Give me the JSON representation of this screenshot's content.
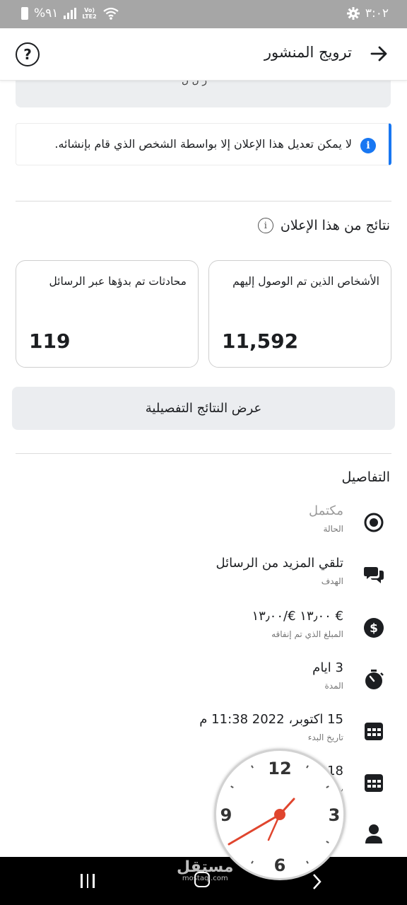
{
  "status_bar": {
    "time": "٣:٠٢",
    "battery": "%٩١",
    "network_top": "Vo)",
    "network_bottom": "LTE2"
  },
  "header": {
    "title": "ترويج المنشور"
  },
  "partial_top_text": "ر ل ل",
  "notice": {
    "text": "لا يمكن تعديل هذا الإعلان إلا بواسطة الشخص الذي قام بإنشائه."
  },
  "results": {
    "title": "نتائج من هذا الإعلان",
    "metrics": [
      {
        "label": "الأشخاص الذين تم الوصول إليهم",
        "value": "11,592"
      },
      {
        "label": "محادثات تم بدؤها عبر الرسائل",
        "value": "119"
      }
    ],
    "detail_button": "عرض النتائج التفصيلية"
  },
  "details": {
    "title": "التفاصيل",
    "rows": [
      {
        "icon": "status-radio-icon",
        "value": "مكتمل",
        "label": "الحالة"
      },
      {
        "icon": "chat-bubbles-icon",
        "value": "تلقي المزيد من الرسائل",
        "label": "الهدف"
      },
      {
        "icon": "dollar-icon",
        "value": "€ ١٣٫٠٠ €/١٣٫٠٠",
        "label": "المبلغ الذي تم إنفاقه"
      },
      {
        "icon": "stopwatch-icon",
        "value": "3 ايام",
        "label": "المدة"
      },
      {
        "icon": "calendar-icon",
        "value": "15 اكتوبر، 2022 11:38 م",
        "label": "تاريخ البدء"
      },
      {
        "icon": "calendar-icon",
        "value": "18 ... 11 م",
        "label": "ت"
      },
      {
        "icon": "person-icon",
        "value": "",
        "label": ""
      }
    ]
  },
  "clock": {
    "numbers": [
      "12",
      "3",
      "6",
      "9"
    ]
  },
  "watermark": {
    "arabic": "مستقل",
    "latin": "mostaql.com"
  },
  "colors": {
    "accent": "#1877f2",
    "clock_hands": "#e0452e",
    "status_bar": "#a6a6a6"
  }
}
